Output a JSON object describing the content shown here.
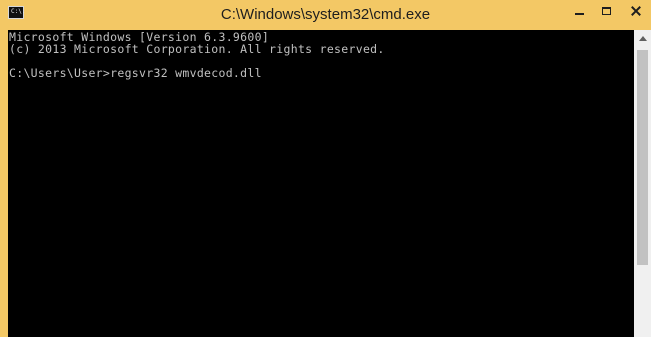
{
  "window": {
    "title": "C:\\Windows\\system32\\cmd.exe",
    "icon_label": "C:\\."
  },
  "console": {
    "lines": [
      "Microsoft Windows [Version 6.3.9600]",
      "(c) 2013 Microsoft Corporation. All rights reserved.",
      "",
      "C:\\Users\\User>regsvr32 wmvdecod.dll"
    ]
  },
  "colors": {
    "frame": "#f3c865",
    "console_background": "#000000",
    "console_text": "#c0c0c0"
  },
  "icons": {
    "app": "cmd-icon",
    "minimize": "minimize-icon",
    "maximize": "maximize-icon",
    "close": "close-icon",
    "scroll_up": "scroll-up-arrow-icon"
  }
}
